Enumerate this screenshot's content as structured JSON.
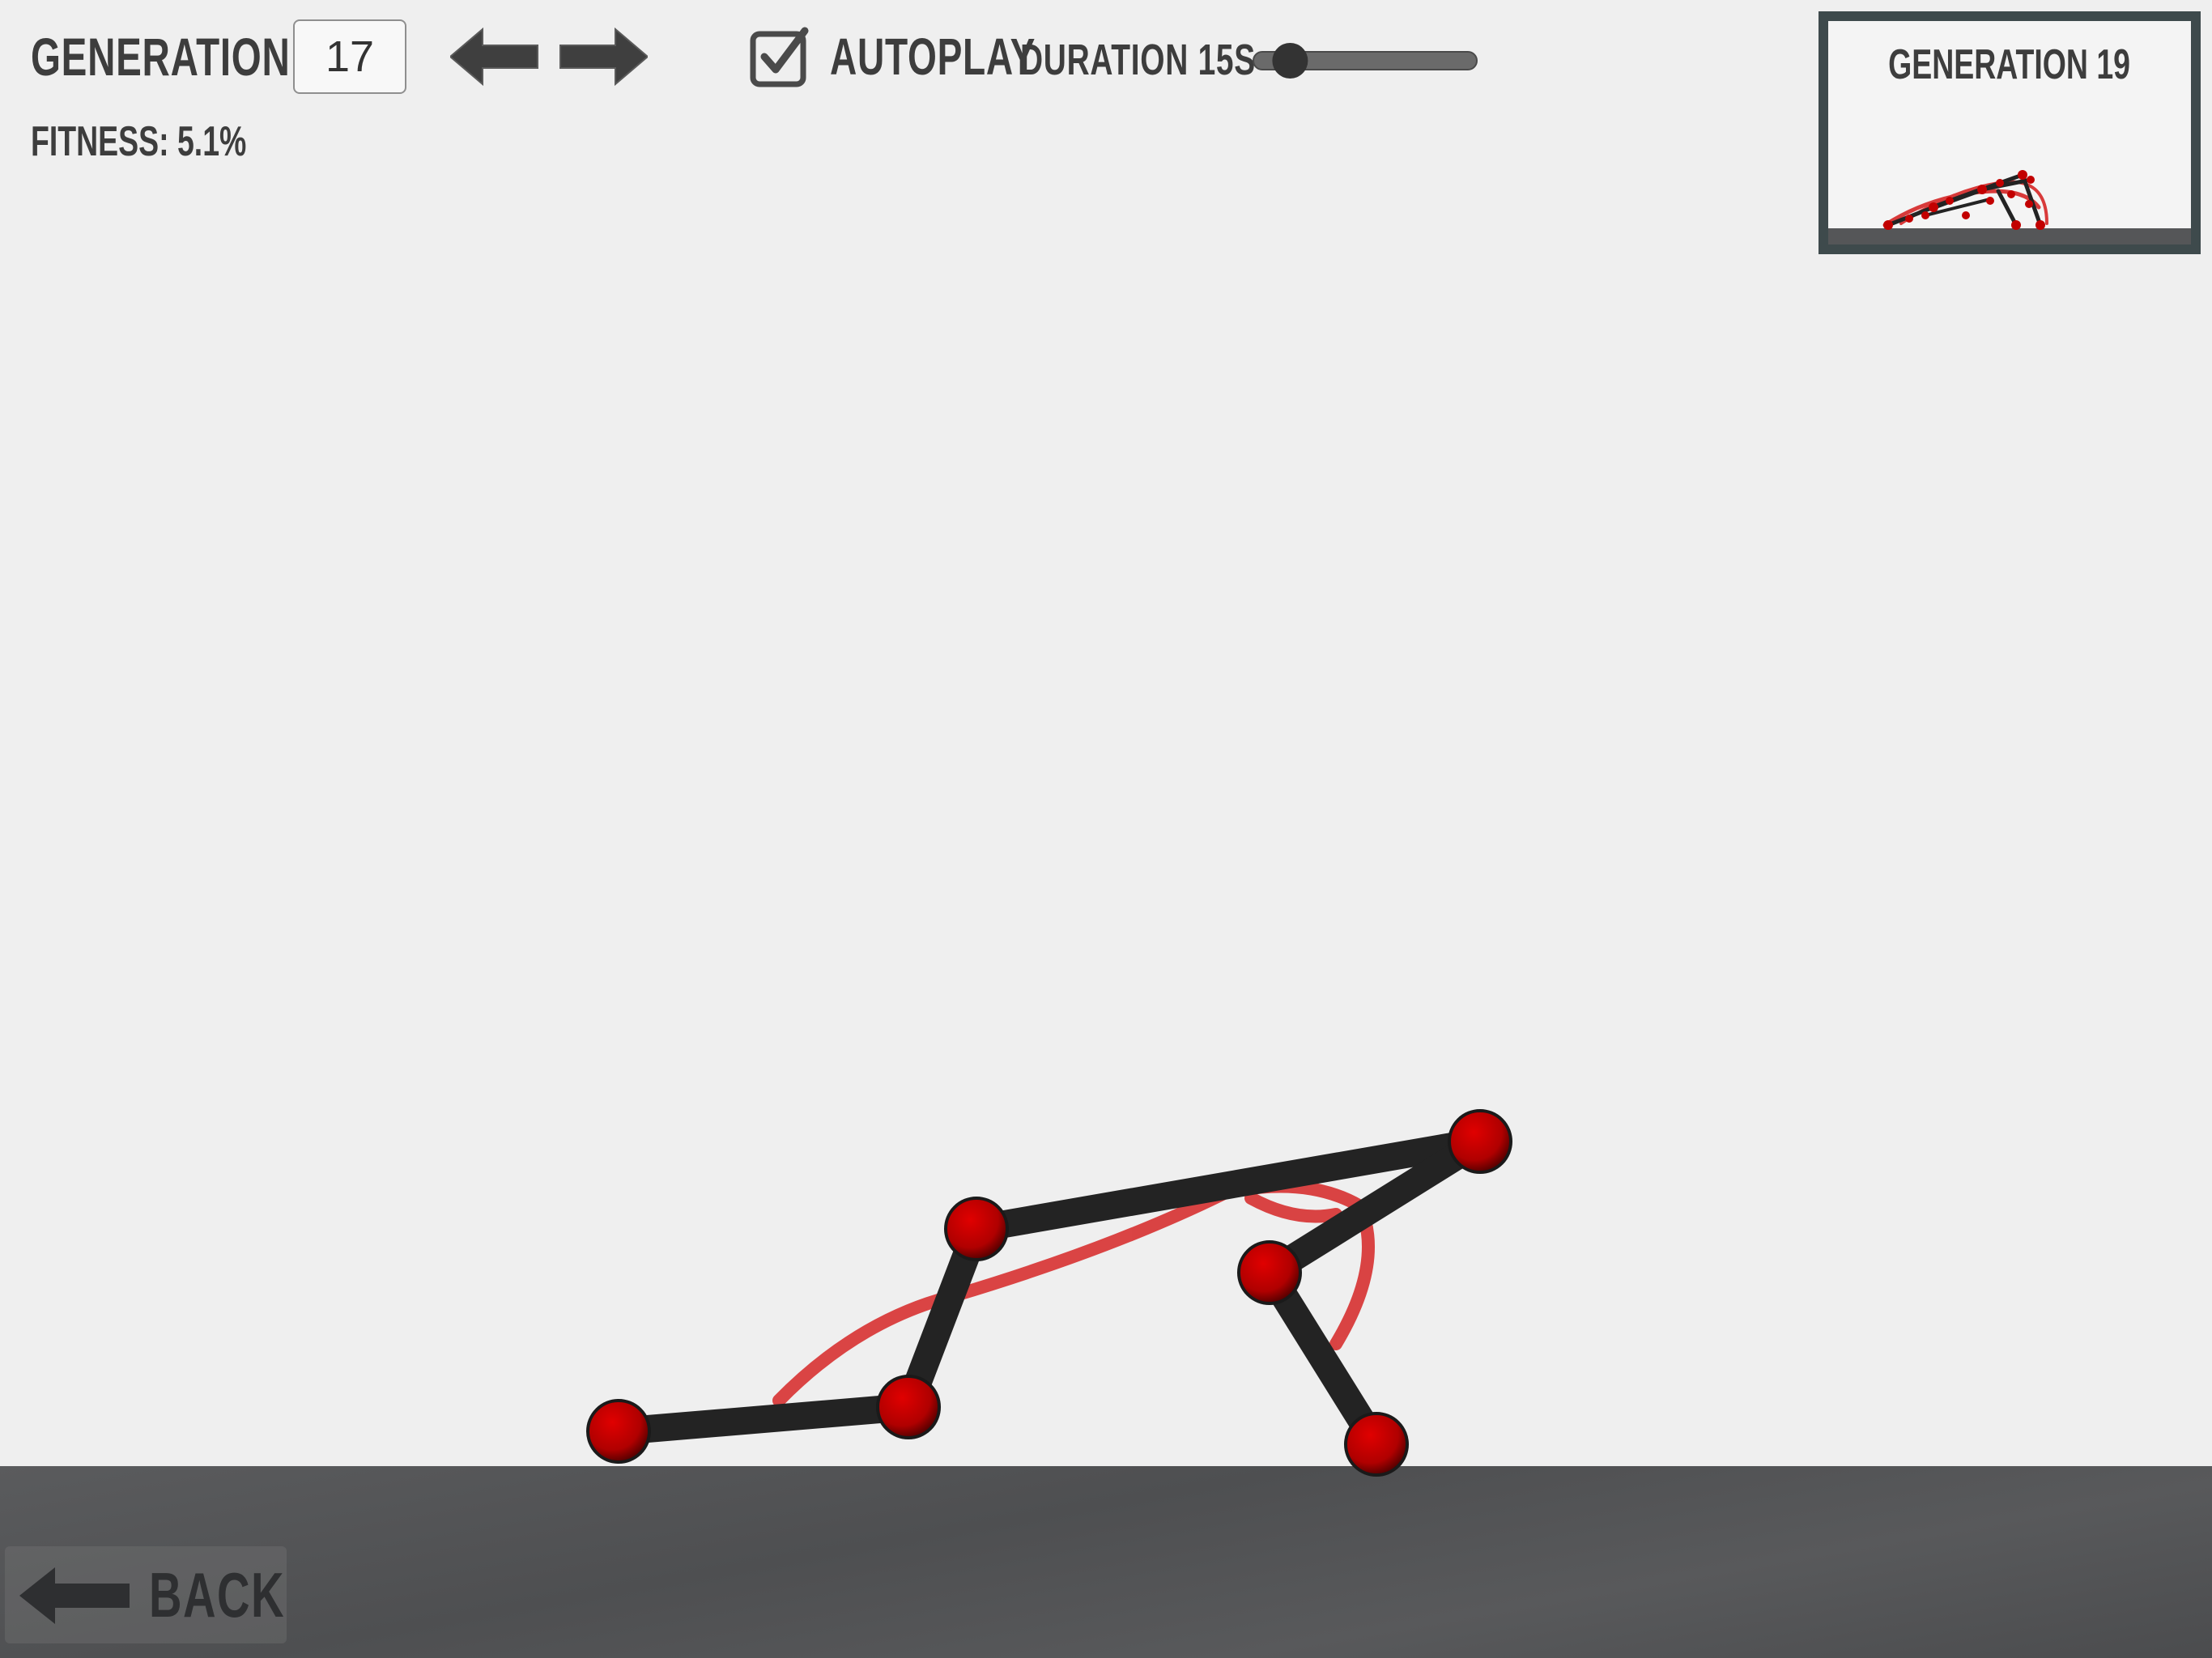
{
  "header": {
    "generation_label": "GENERATION",
    "generation_value": "17",
    "fitness_text": "FITNESS: 5.1%",
    "autoplay_label": "AUTOPLAY",
    "autoplay_checked": true,
    "duration_label": "DURATION 15S",
    "duration_slider_level": 0.1
  },
  "preview": {
    "title": "GENERATION 19"
  },
  "footer": {
    "back_label": "BACK"
  },
  "colors": {
    "background": "#efefef",
    "ui_text": "#3d3d3d",
    "bone": "#232323",
    "joint": "#c20000",
    "muscle": "#d83a3a",
    "ground": "#545557",
    "preview_border": "#3e4a4c"
  },
  "icons": {
    "prev": "arrow-left-icon",
    "next": "arrow-right-icon",
    "autoplay": "checkbox-checked-icon",
    "back": "back-arrow-icon"
  }
}
